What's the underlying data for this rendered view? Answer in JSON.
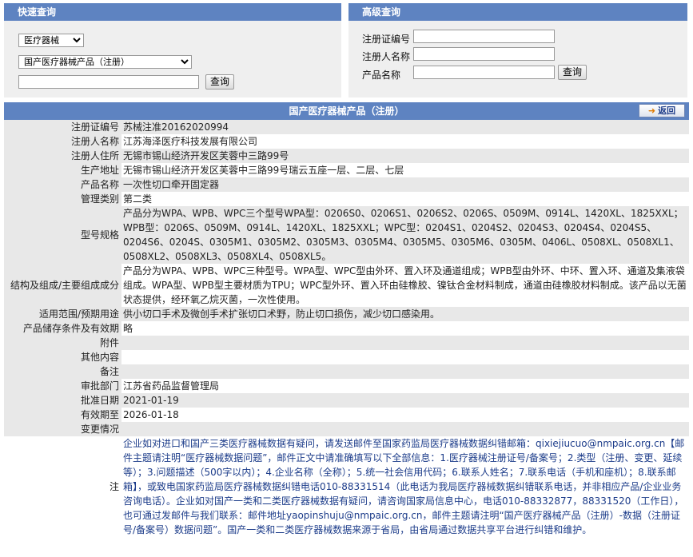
{
  "quick_search": {
    "title": "快速查询",
    "category_select": "医疗器械",
    "type_select": "国产医疗器械产品（注册）",
    "keyword_value": "",
    "search_label": "查询"
  },
  "advanced_search": {
    "title": "高级查询",
    "reg_no_label": "注册证编号",
    "registrant_label": "注册人名称",
    "product_label": "产品名称",
    "search_label": "查询"
  },
  "detail": {
    "title": "国产医疗器械产品（注册）",
    "back_label": "返回",
    "rows": [
      {
        "label": "注册证编号",
        "value": "苏械注准20162020994"
      },
      {
        "label": "注册人名称",
        "value": "江苏海泽医疗科技发展有限公司"
      },
      {
        "label": "注册人住所",
        "value": "无锡市锡山经济开发区芙蓉中三路99号"
      },
      {
        "label": "生产地址",
        "value": "无锡市锡山经济开发区芙蓉中三路99号瑞云五座一层、二层、七层"
      },
      {
        "label": "产品名称",
        "value": "一次性切口牵开固定器"
      },
      {
        "label": "管理类别",
        "value": "第二类"
      },
      {
        "label": "型号规格",
        "value": "产品分为WPA、WPB、WPC三个型号WPA型：0206S0、0206S1、0206S2、0206S、0509M、0914L、1420XL、1825XXL；WPB型：0206S、0509M、0914L、1420XL、1825XXL；WPC型：0204S1、0204S2、0204S3、0204S4、0204S5、0204S6、0204S、0305M1、0305M2、0305M3、0305M4、0305M5、0305M6、0305M、0406L、0508XL、0508XL1、0508XL2、0508XL3、0508XL4、0508XL5。"
      },
      {
        "label": "结构及组成/主要组成成分",
        "value": "产品分为WPA、WPB、WPC三种型号。WPA型、WPC型由外环、置入环及通道组成；WPB型由外环、中环、置入环、通道及集液袋组成。WPA型、WPB型主要材质为TPU；WPC型外环、置入环由硅橡胶、镍钛合金材料制成，通道由硅橡胶材料制成。该产品以无菌状态提供，经环氧乙烷灭菌，一次性使用。"
      },
      {
        "label": "适用范围/预期用途",
        "value": "供小切口手术及微创手术扩张切口术野，防止切口损伤，减少切口感染用。"
      },
      {
        "label": "产品储存条件及有效期",
        "value": "略"
      },
      {
        "label": "附件",
        "value": ""
      },
      {
        "label": "其他内容",
        "value": ""
      },
      {
        "label": "备注",
        "value": ""
      },
      {
        "label": "审批部门",
        "value": "江苏省药品监督管理局"
      },
      {
        "label": "批准日期",
        "value": "2021-01-19"
      },
      {
        "label": "有效期至",
        "value": "2026-01-18"
      },
      {
        "label": "变更情况",
        "value": ""
      }
    ],
    "note_label": "注",
    "note_text": "企业如对进口和国产三类医疗器械数据有疑问，请发送邮件至国家药监局医疗器械数据纠错邮箱：qixiejiucuo@nmpaic.org.cn【邮件主题请注明“医疗器械数据问题”，邮件正文中请准确填写以下全部信息：1.医疗器械注册证号/备案号；2.类型（注册、变更、延续等）；3.问题描述（500字以内）；4.企业名称（全称）；5.统一社会信用代码；6.联系人姓名；7.联系电话（手机和座机）；8.联系邮箱】，或致电国家药监局医疗器械数据纠错电话010-88331514（此电话为我局医疗器械数据纠错联系电话，并非相应产品/企业业务咨询电话）。企业如对国产一类和二类医疗器械数据有疑问，请咨询国家局信息中心，电话010-88332877，88331520（工作日），也可通过发邮件与我们联系：邮件地址yaopinshuju@nmpaic.org.cn，邮件主题请注明“国产医疗器械产品（注册）-数据（注册证号/备案号）数据问题”。国产一类和二类医疗器械数据来源于省局，由省局通过数据共享平台进行纠错和维护。"
  }
}
